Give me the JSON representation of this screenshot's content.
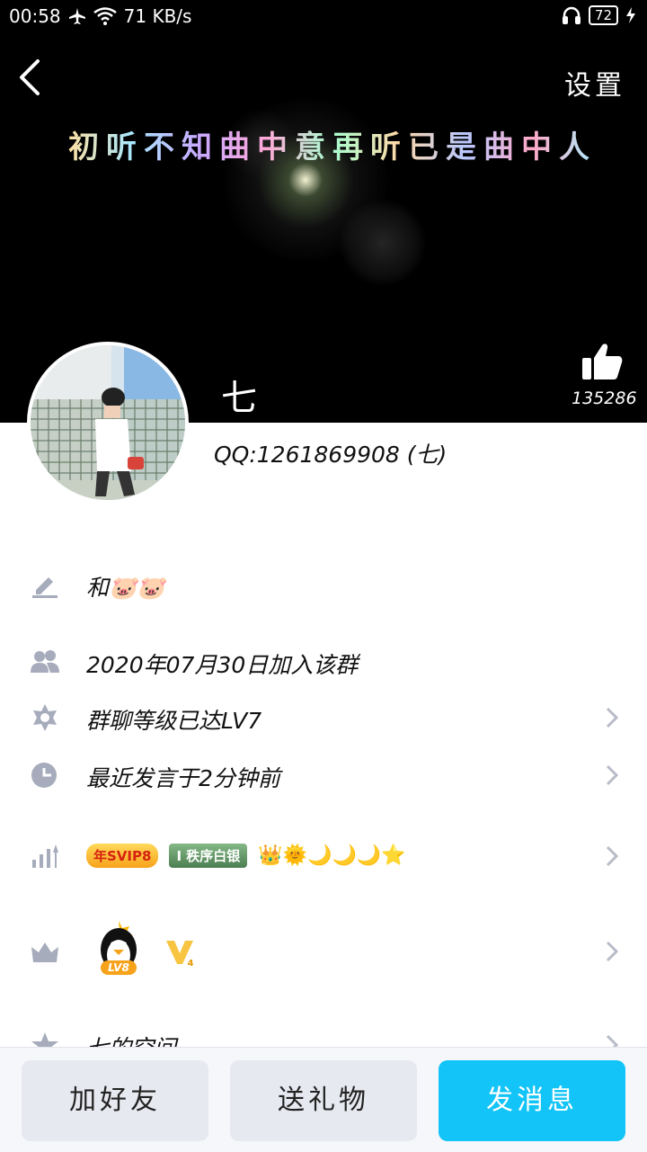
{
  "status_bar": {
    "time": "00:58",
    "network_speed": "71 KB/s",
    "battery": "72",
    "icons": [
      "airplane-icon",
      "wifi-icon",
      "headphones-icon",
      "charging-icon"
    ]
  },
  "header": {
    "settings_label": "设置",
    "cover_title": "初听不知曲中意再听已是曲中人",
    "like_count": "135286"
  },
  "profile": {
    "nickname": "七",
    "qq_id": "QQ:1261869908 (七)"
  },
  "info_rows": [
    {
      "icon": "pencil-icon",
      "text": "和🐷🐷",
      "chevron": false
    },
    {
      "icon": "group-members-icon",
      "text": "2020年07月30日加入该群",
      "chevron": false
    },
    {
      "icon": "star-badge-icon",
      "text": "群聊等级已达LV7",
      "chevron": true
    },
    {
      "icon": "clock-icon",
      "text": "最近发言于2分钟前",
      "chevron": true
    },
    {
      "icon": "bar-chart-icon",
      "text": "",
      "chevron": true
    },
    {
      "icon": "crown-icon",
      "text": "",
      "chevron": true
    },
    {
      "icon": "star-icon",
      "text": "七的空间",
      "chevron": true
    }
  ],
  "badges": {
    "svip": "年SVIP8",
    "silver_letter": "I",
    "silver": "秩序白银",
    "level_emojis": "👑🌞🌙🌙🌙⭐",
    "qq_level": "LV8",
    "vip_level": "4"
  },
  "bottom_buttons": {
    "add_friend": "加好友",
    "send_gift": "送礼物",
    "send_message": "发消息"
  },
  "colors": {
    "accent": "#12c4f7",
    "icon_gray": "#a6acbc"
  }
}
